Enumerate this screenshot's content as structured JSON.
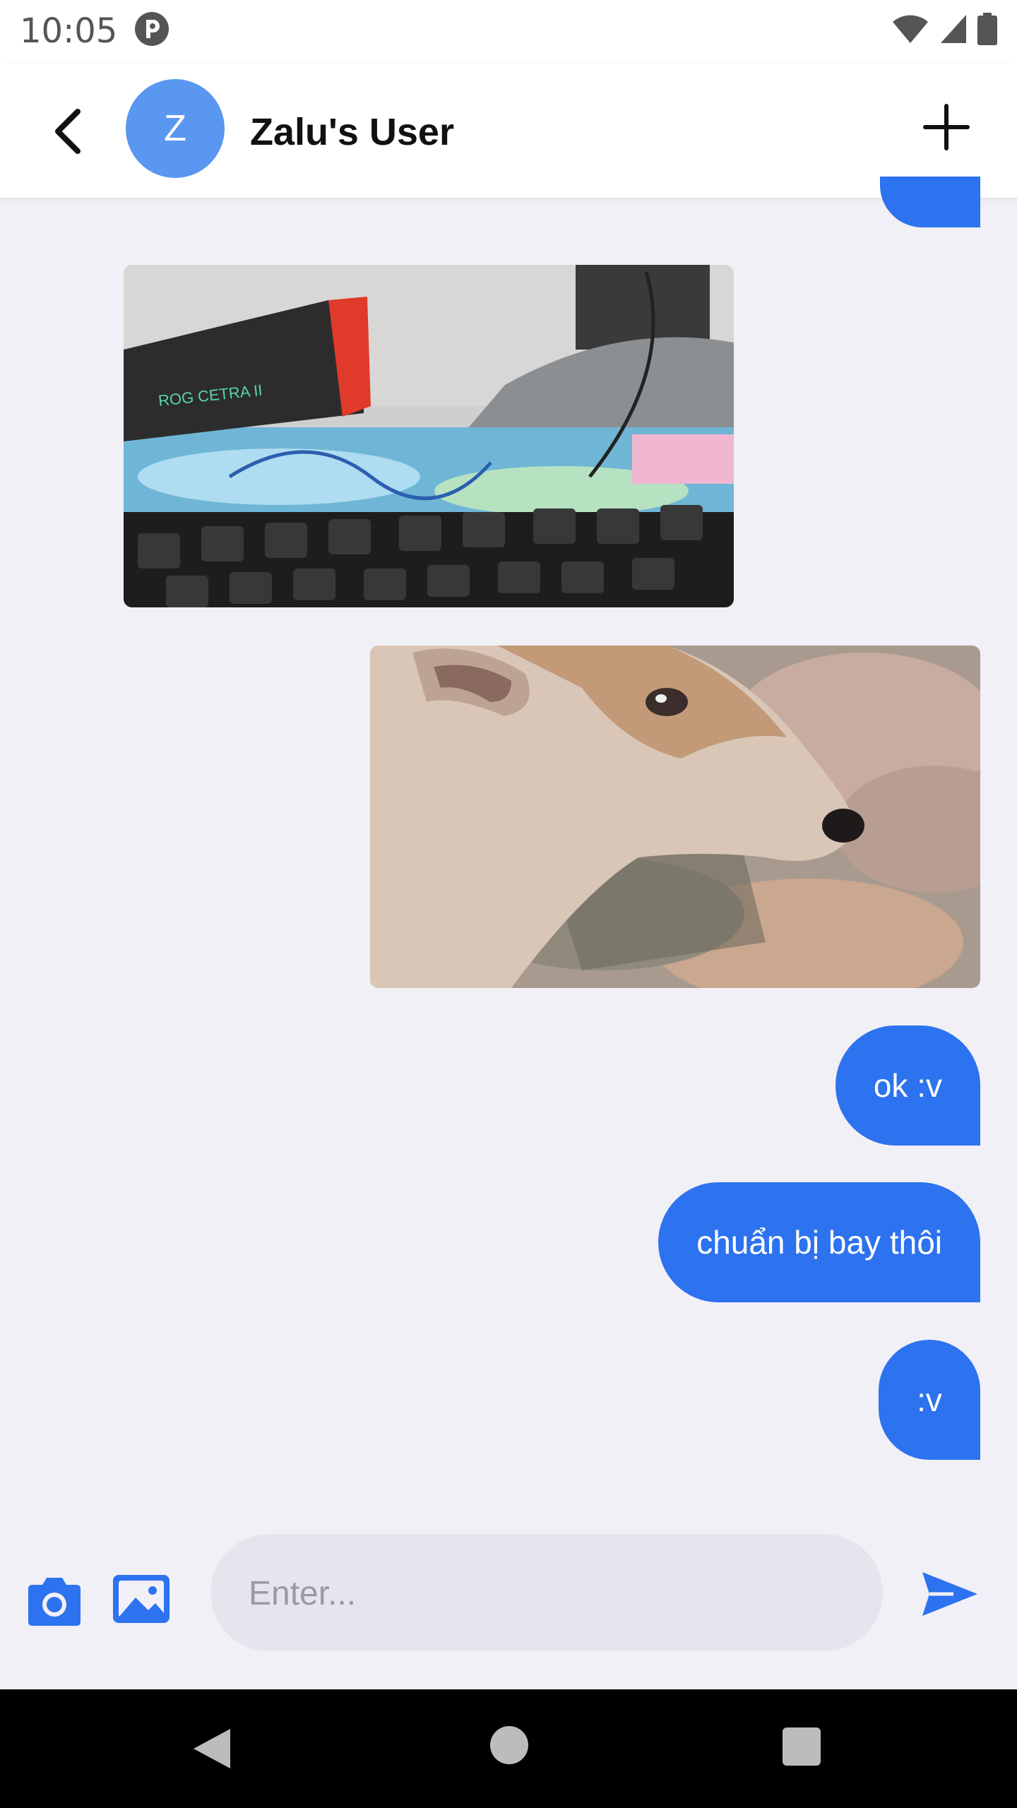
{
  "status_bar": {
    "time": "10:05"
  },
  "header": {
    "avatar_initial": "Z",
    "contact_name": "Zalu's User"
  },
  "messages": [
    {
      "type": "image",
      "from": "contact",
      "description_icon": "photo-desk-keyboard"
    },
    {
      "type": "image",
      "from": "me",
      "description_icon": "photo-dog"
    },
    {
      "type": "text",
      "from": "me",
      "text": "ok :v"
    },
    {
      "type": "text",
      "from": "me",
      "text": "chuẩn bị bay thôi"
    },
    {
      "type": "text",
      "from": "me",
      "text": ":v"
    }
  ],
  "composer": {
    "placeholder": "Enter..."
  },
  "colors": {
    "accent": "#2d72ef",
    "avatar": "#5a97f0",
    "background": "#f1f0f6",
    "input_bg": "#e6e5ee"
  },
  "icons": [
    "back-arrow-icon",
    "plus-icon",
    "camera-icon",
    "image-icon",
    "send-icon",
    "wifi-icon",
    "signal-icon",
    "battery-icon"
  ]
}
